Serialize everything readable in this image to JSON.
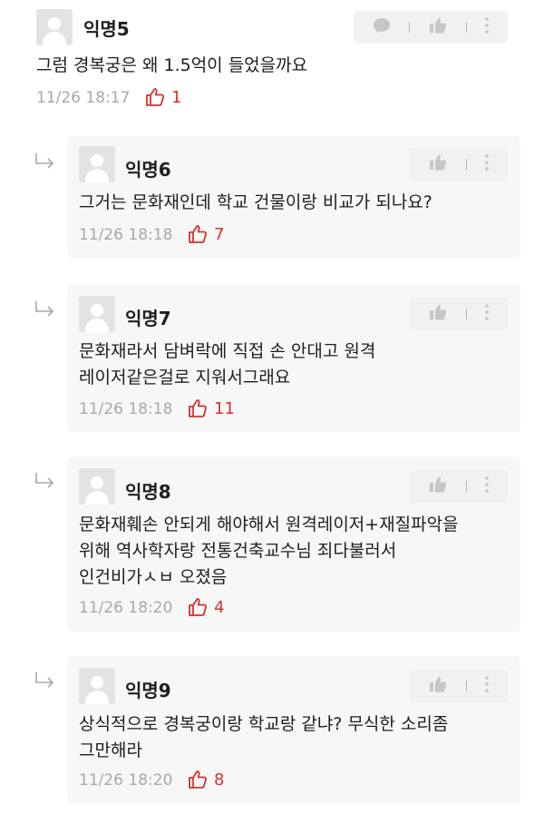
{
  "comments": [
    {
      "name": "익명5",
      "text": [
        "그럼 경복궁은 왜 1.5억이 들었을까요"
      ],
      "time": "11/26 18:17",
      "likes": "1"
    },
    {
      "name": "익명6",
      "text": [
        "그거는 문화재인데 학교 건물이랑 비교가 되나요?"
      ],
      "time": "11/26 18:18",
      "likes": "7"
    },
    {
      "name": "익명7",
      "text": [
        "문화재라서 담벼락에 직접 손 안대고 원격",
        "레이저같은걸로 지워서그래요"
      ],
      "time": "11/26 18:18",
      "likes": "11"
    },
    {
      "name": "익명8",
      "text": [
        "문화재훼손 안되게 해야해서 원격레이저+재질파악을",
        "위해 역사학자랑 전통건축교수님 죄다불러서",
        "인건비가ㅅㅂ 오졌음"
      ],
      "time": "11/26 18:20",
      "likes": "4"
    },
    {
      "name": "익명9",
      "text": [
        "상식적으로 경복궁이랑 학교랑 같냐? 무식한 소리좀",
        "그만해라"
      ],
      "time": "11/26 18:20",
      "likes": "8"
    }
  ],
  "icons": {
    "comment": "comment-bubble-icon",
    "like": "thumbs-up-icon",
    "more": "more-vertical-icon",
    "reply": "reply-arrow-icon",
    "vote": "outline-thumb-icon"
  },
  "colors": {
    "like": "#d2322e",
    "time": "#a8a8a8",
    "card": "#f7f7f7",
    "action_bg": "#f1f1f1"
  }
}
